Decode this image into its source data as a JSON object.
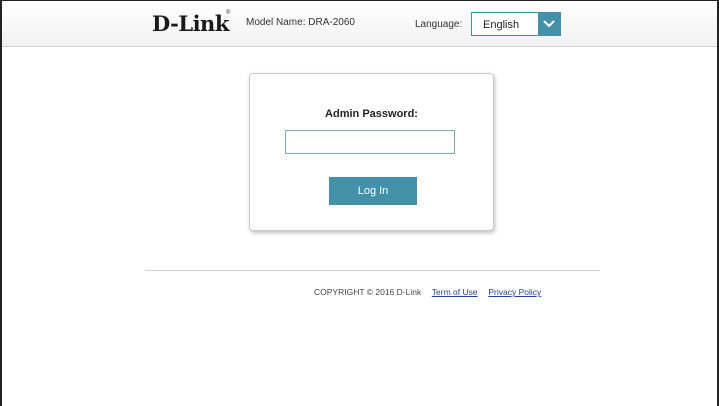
{
  "header": {
    "logo": "D-Link",
    "logo_mark": "®",
    "model_name": "Model Name: DRA-2060",
    "language_label": "Language:",
    "language_selected": "English"
  },
  "login": {
    "admin_password_label": "Admin Password:",
    "password_value": "",
    "login_button_label": "Log In"
  },
  "footer": {
    "copyright": "COPYRIGHT © 2016 D-Link",
    "terms_link": "Term of Use",
    "privacy_link": "Privacy Policy"
  },
  "colors": {
    "accent": "#4291a8",
    "link": "#1f3fa0"
  },
  "icons": {
    "language_dropdown": "chevron-down-icon"
  }
}
